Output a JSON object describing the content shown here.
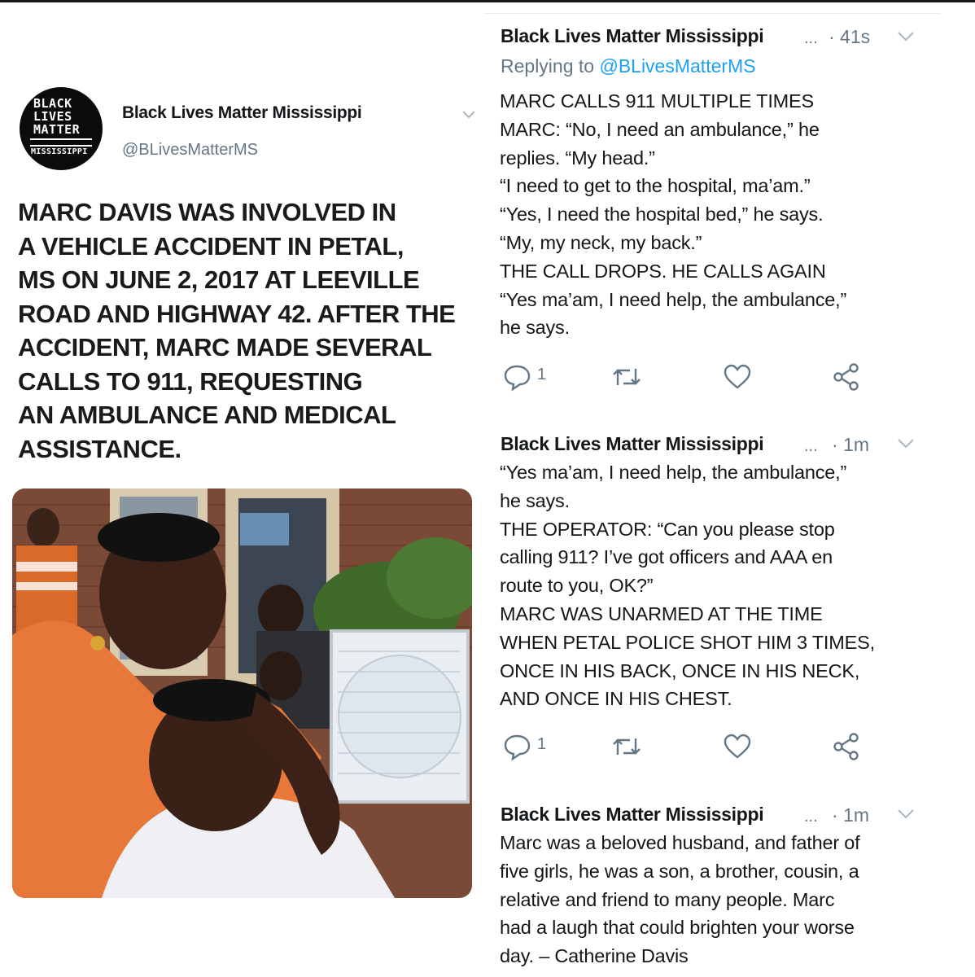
{
  "left_tweet": {
    "logo": {
      "line1": "BLACK",
      "line2": "LIVES",
      "line3": "MATTER",
      "line4": "MISSISSIPPI"
    },
    "account_name": "Black Lives Matter Mississippi",
    "handle": "@BLivesMatterMS",
    "headline": [
      "MARC DAVIS WAS INVOLVED IN",
      "A VEHICLE ACCIDENT IN PETAL,",
      "MS ON JUNE 2, 2017 AT LEEVILLE",
      "ROAD AND HIGHWAY 42. AFTER THE",
      "ACCIDENT, MARC MADE SEVERAL",
      "CALLS TO 911, REQUESTING",
      "AN AMBULANCE AND MEDICAL",
      "ASSISTANCE."
    ]
  },
  "tweets": [
    {
      "name": "Black Lives Matter Mississippi",
      "ellipsis": "...",
      "time": "· 41s",
      "replying_prefix": "Replying to",
      "replying_handle": "@BLivesMatterMS",
      "lines": [
        "MARC CALLS 911 MULTIPLE TIMES",
        "MARC: “No, I need an ambulance,” he",
        "replies. “My head.”",
        "“I need to get to the hospital, ma’am.”",
        "“Yes, I need the hospital bed,” he says.",
        "“My, my neck, my back.”",
        "THE CALL DROPS. HE CALLS AGAIN",
        "“Yes ma’am, I need help, the ambulance,”",
        "he says."
      ],
      "reply_count": "1"
    },
    {
      "name": "Black Lives Matter Mississippi",
      "ellipsis": "...",
      "time": "· 1m",
      "lines": [
        "“Yes ma’am, I need help, the ambulance,”",
        "he says.",
        "THE OPERATOR: “Can you please stop",
        "calling 911? I’ve got officers and AAA en",
        "route to you, OK?”",
        "MARC WAS UNARMED AT THE TIME",
        "WHEN PETAL POLICE  SHOT HIM 3 TIMES,",
        "ONCE IN HIS BACK, ONCE IN HIS NECK,",
        "AND ONCE IN HIS CHEST."
      ],
      "reply_count": "1"
    },
    {
      "name": "Black Lives Matter Mississippi",
      "ellipsis": "...",
      "time": "· 1m",
      "lines": [
        "Marc was a beloved husband, and father of",
        "five girls, he was a son, a brother, cousin, a",
        "relative and friend to many people. Marc",
        "had a laugh that could brighten your worse",
        "day.  – Catherine Davis"
      ]
    }
  ],
  "icons": [
    "reply-icon",
    "retweet-icon",
    "like-icon",
    "share-icon",
    "chevron-down-icon"
  ],
  "colors": {
    "link": "#1da1f2",
    "muted": "#657786",
    "text": "#14171a"
  }
}
